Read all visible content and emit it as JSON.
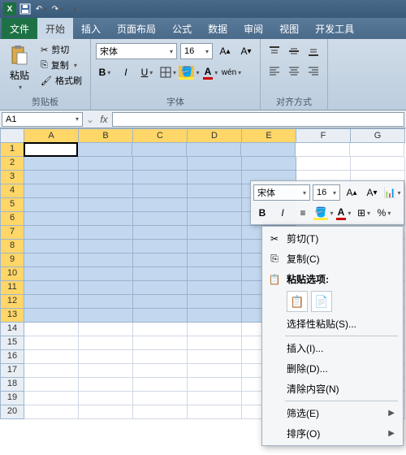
{
  "titlebar": {
    "save_tip": "保存",
    "undo_tip": "撤销",
    "redo_tip": "恢复"
  },
  "tabs": {
    "file": "文件",
    "home": "开始",
    "insert": "插入",
    "layout": "页面布局",
    "formulas": "公式",
    "data": "数据",
    "review": "审阅",
    "view": "视图",
    "dev": "开发工具"
  },
  "ribbon": {
    "clipboard": {
      "label": "剪贴板",
      "paste": "粘贴",
      "cut": "剪切",
      "copy": "复制",
      "format_painter": "格式刷"
    },
    "font": {
      "label": "字体",
      "name": "宋体",
      "size": "16"
    },
    "align": {
      "label": "对齐方式"
    }
  },
  "namebox": {
    "ref": "A1"
  },
  "sheet": {
    "cols": [
      "A",
      "B",
      "C",
      "D",
      "E",
      "F",
      "G"
    ],
    "sel_cols": 5,
    "rows": 20,
    "sel_rows": 13
  },
  "minibar": {
    "font": "宋体",
    "size": "16"
  },
  "ctx": {
    "cut": "剪切(T)",
    "copy": "复制(C)",
    "paste_options": "粘贴选项:",
    "paste_special": "选择性粘贴(S)...",
    "insert": "插入(I)...",
    "delete": "删除(D)...",
    "clear": "清除内容(N)",
    "filter": "筛选(E)",
    "sort": "排序(O)"
  }
}
